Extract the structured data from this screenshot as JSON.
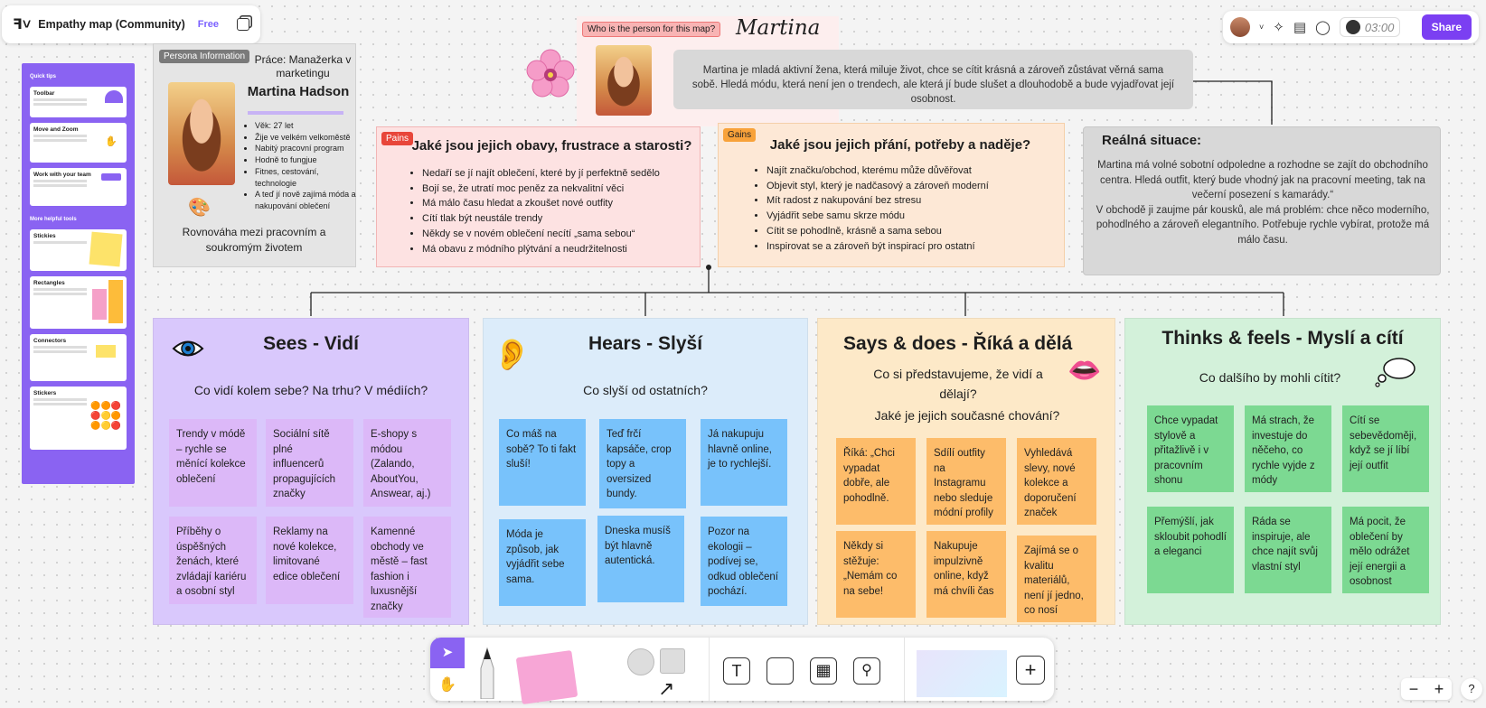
{
  "app": {
    "file_title": "Empathy map (Community)",
    "plan_badge": "Free",
    "timer": "03:00",
    "share_label": "Share"
  },
  "tips": {
    "heading": "Quick tips",
    "more_heading": "More helpful tools",
    "items": [
      "Toolbar",
      "Move and Zoom",
      "Work with your team",
      "Stickies",
      "Rectangles",
      "Connectors",
      "Stickers"
    ]
  },
  "persona": {
    "tag": "Persona Information",
    "job": "Práce: Manažerka v marketingu",
    "name": "Martina Hadson",
    "facts": [
      "Věk: 27 let",
      "Žije ve velkém velkoměstě",
      "Nabitý pracovní program",
      "Hodně to fungjue",
      "Fitnes, cestování, technologie",
      "A teď jí nově zajímá móda a nakupování oblečení"
    ],
    "motto": "Rovnováha mezi pracovním a soukromým životem"
  },
  "who": {
    "tag": "Who is the person for this map?",
    "name": "Martina"
  },
  "intro": "Martina je mladá aktivní žena, která miluje život, chce se cítit krásná a zároveň zůstávat věrná sama sobě. Hledá módu, která není jen o trendech, ale která jí bude slušet a dlouhodobě a bude vyjadřovat její osobnost.",
  "pains": {
    "tag": "Pains",
    "title": "Jaké jsou jejich obavy, frustrace a starosti?",
    "items": [
      "Nedaří se jí najít oblečení, které by jí perfektně sedělo",
      "Bojí se, že utratí moc peněz za nekvalitní věci",
      "Má málo času hledat a zkoušet nové outfity",
      "Cítí tlak být neustále trendy",
      "Někdy se v novém oblečení necítí „sama sebou“",
      "Má obavu z módního plýtvání a neudržitelnosti"
    ]
  },
  "gains": {
    "tag": "Gains",
    "title": "Jaké jsou jejich přání, potřeby a naděje?",
    "items": [
      "Najít značku/obchod, kterému může důvěřovat",
      "Objevit styl, který je nadčasový a zároveň moderní",
      "Mít radost z nakupování bez stresu",
      "Vyjádřit sebe samu skrze módu",
      "Cítit se pohodlně, krásně a sama sebou",
      "Inspirovat se a zároveň být inspirací pro ostatní"
    ]
  },
  "real": {
    "title": "Reálná situace:",
    "text1": "Martina má volné sobotní odpoledne a rozhodne se zajít do obchodního centra. Hledá outfit, který bude vhodný jak na pracovní meeting, tak na večerní posezení s kamarády.“",
    "text2": "V obchodě ji zaujme pár kousků, ale má problém: chce něco moderního, pohodlného a zároveň elegantního. Potřebuje rychle vybírat, protože má málo času."
  },
  "sees": {
    "title": "Sees - Vidí",
    "subtitle": "Co vidí kolem sebe? Na trhu? V médiích?",
    "notes": [
      "Trendy v módě – rychle se měnící kolekce oblečení",
      "Sociální sítě plné influencerů propagujících značky",
      "E-shopy s módou (Zalando, AboutYou, Answear, aj.)",
      "Příběhy o úspěšných ženách, které zvládají kariéru a osobní styl",
      "Reklamy na nové kolekce, limitované edice oblečení",
      "Kamenné obchody ve městě – fast fashion i luxusnější značky"
    ]
  },
  "hears": {
    "title": "Hears - Slyší",
    "subtitle": "Co slyší od ostatních?",
    "notes": [
      "Co máš na sobě? To ti fakt sluší!",
      "Teď frčí kapsáče, crop topy a oversized bundy.",
      "Já nakupuju hlavně online, je to rychlejší.",
      "Móda je způsob, jak vyjádřit sebe sama.",
      "Dneska musíš být hlavně autentická.",
      "Pozor na ekologii – podívej se, odkud oblečení pochází."
    ]
  },
  "says": {
    "title": "Says & does - Říká a dělá",
    "subtitle1": "Co si představujeme, že vidí a dělají?",
    "subtitle2": "Jaké je jejich současné chování?",
    "notes": [
      "Říká: „Chci vypadat dobře, ale pohodlně.",
      "Sdílí outfity na Instagramu nebo sleduje módní profily",
      "Vyhledává slevy, nové kolekce a doporučení značek",
      "Někdy si stěžuje: „Nemám co na sebe!",
      "Nakupuje impulzivně online, když má chvíli čas",
      "Zajímá se o kvalitu materiálů, není jí jedno, co nosí"
    ]
  },
  "thinks": {
    "title": "Thinks & feels - Myslí a cítí",
    "subtitle": "Co dalšího by mohli cítit?",
    "notes": [
      "Chce vypadat stylově a přitažlivě i v pracovním shonu",
      "Má strach, že investuje do něčeho, co rychle vyjde z módy",
      "Cítí se sebevědoměji, když se jí líbí její outfit",
      "Přemýšlí, jak skloubit pohodlí a eleganci",
      "Ráda se inspiruje, ale chce najít svůj vlastní styl",
      "Má pocit, že oblečení by mělo odrážet její energii a osobnost"
    ]
  },
  "zoom": {
    "minus": "−",
    "plus": "+"
  },
  "help": "?",
  "colors": {
    "accent": "#7b3ff2",
    "sees_bg": "#d9c8fc",
    "hears_bg": "#dcecfa",
    "says_bg": "#fde9c8",
    "thinks_bg": "#d3f1da"
  }
}
